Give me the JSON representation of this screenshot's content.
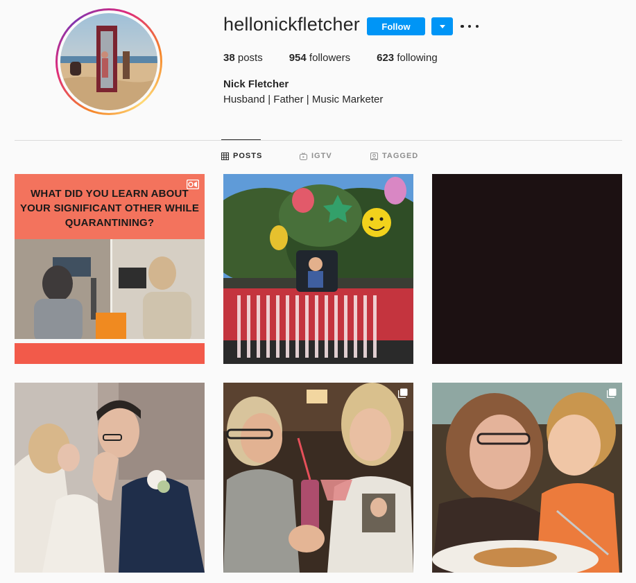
{
  "profile": {
    "username": "hellonickfletcher",
    "follow_label": "Follow",
    "full_name": "Nick Fletcher",
    "bio": "Husband | Father | Music Marketer"
  },
  "stats": {
    "posts_count": "38",
    "posts_label": "posts",
    "followers_count": "954",
    "followers_label": "followers",
    "following_count": "623",
    "following_label": "following"
  },
  "tabs": [
    {
      "label": "POSTS",
      "icon": "grid-icon",
      "active": true
    },
    {
      "label": "IGTV",
      "icon": "igtv-icon",
      "active": false
    },
    {
      "label": "TAGGED",
      "icon": "tagged-icon",
      "active": false
    }
  ],
  "posts": [
    {
      "name": "quarantine-podcast-video",
      "overlay_text": [
        "WHAT DID YOU LEARN ABOUT",
        "YOUR SIGNIFICANT OTHER WHILE",
        "QUARANTINING?"
      ],
      "badge": "video-icon"
    },
    {
      "name": "truck-balloons-photo",
      "badge": ""
    },
    {
      "name": "dark-photo",
      "badge": ""
    },
    {
      "name": "wedding-kiss-photo",
      "badge": ""
    },
    {
      "name": "restaurant-drinks-photo",
      "badge": "carousel-icon"
    },
    {
      "name": "mother-child-photo",
      "badge": "carousel-icon"
    }
  ],
  "colors": {
    "accent": "#0095f6",
    "text": "#262626",
    "muted": "#8e8e8e",
    "background": "#fafafa",
    "divider": "#dbdbdb"
  }
}
